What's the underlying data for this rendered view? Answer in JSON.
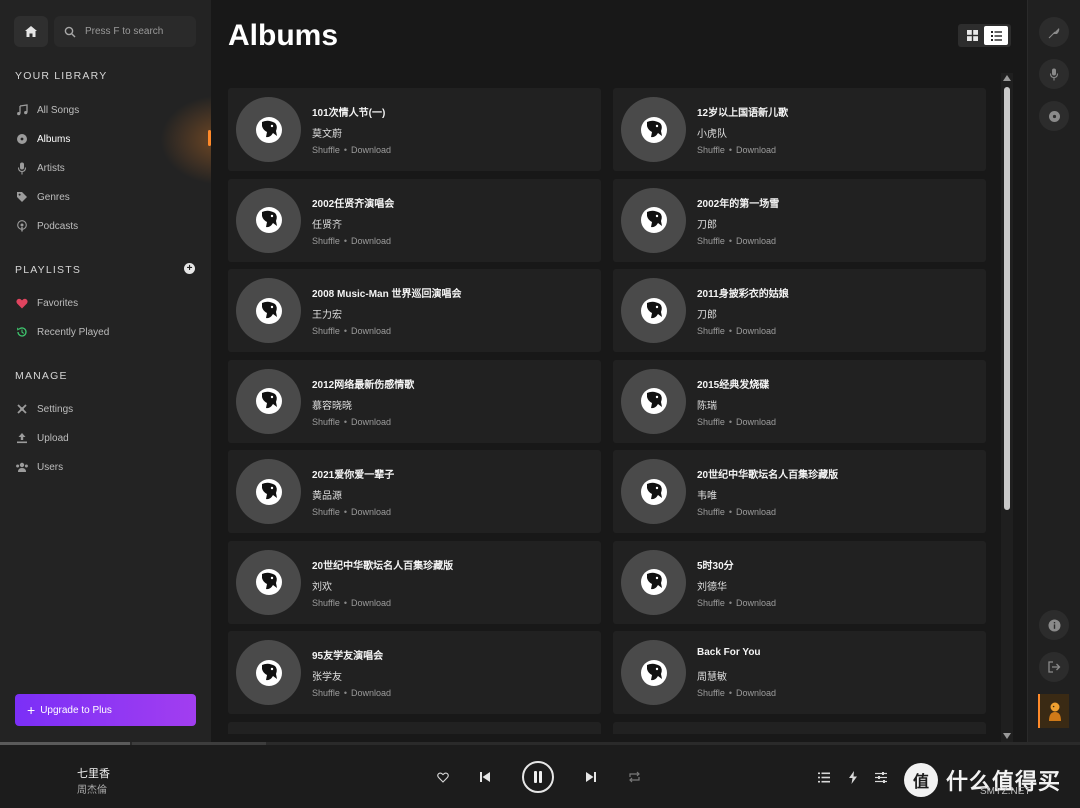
{
  "search": {
    "placeholder": "Press F to search"
  },
  "sidebar": {
    "library_title": "YOUR LIBRARY",
    "library_items": [
      {
        "label": "All Songs",
        "icon": "music-note-icon"
      },
      {
        "label": "Albums",
        "icon": "disc-icon",
        "active": true
      },
      {
        "label": "Artists",
        "icon": "microphone-icon"
      },
      {
        "label": "Genres",
        "icon": "tag-icon"
      },
      {
        "label": "Podcasts",
        "icon": "podcast-icon"
      }
    ],
    "playlists_title": "PLAYLISTS",
    "playlist_items": [
      {
        "label": "Favorites",
        "icon": "heart-icon"
      },
      {
        "label": "Recently Played",
        "icon": "history-icon"
      }
    ],
    "manage_title": "MANAGE",
    "manage_items": [
      {
        "label": "Settings",
        "icon": "settings-icon"
      },
      {
        "label": "Upload",
        "icon": "upload-icon"
      },
      {
        "label": "Users",
        "icon": "users-icon"
      }
    ],
    "upgrade_label": "Upgrade to Plus"
  },
  "main": {
    "title": "Albums",
    "actions": {
      "shuffle": "Shuffle",
      "separator": "•",
      "download": "Download"
    },
    "albums": [
      {
        "title": "101次情人节(一)",
        "artist": "莫文蔚"
      },
      {
        "title": "12岁以上国语新儿歌",
        "artist": "小虎队"
      },
      {
        "title": "2002任贤齐演唱会",
        "artist": "任贤齐"
      },
      {
        "title": "2002年的第一场雪",
        "artist": "刀郎"
      },
      {
        "title": "2008 Music-Man 世界巡回演唱会",
        "artist": "王力宏"
      },
      {
        "title": "2011身披彩衣的姑娘",
        "artist": "刀郎"
      },
      {
        "title": "2012网络最新伤感情歌",
        "artist": "慕容晓晓"
      },
      {
        "title": "2015经典发烧碟",
        "artist": "陈瑞"
      },
      {
        "title": "2021爱你爱一辈子",
        "artist": "黄品源"
      },
      {
        "title": "20世纪中华歌坛名人百集珍藏版",
        "artist": "韦唯"
      },
      {
        "title": "20世纪中华歌坛名人百集珍藏版",
        "artist": "刘欢"
      },
      {
        "title": "5时30分",
        "artist": "刘德华"
      },
      {
        "title": "95友学友演唱会",
        "artist": "张学友"
      },
      {
        "title": "Back For You",
        "artist": "周慧敏"
      }
    ]
  },
  "player": {
    "song_title": "七里香",
    "song_artist": "周杰倫",
    "progress_fraction": 0.12
  },
  "watermark": {
    "text": "什么值得买",
    "sub": "SMYZ.NET",
    "logo": "值"
  },
  "colors": {
    "accent": "#ff8a2a",
    "upgrade_start": "#7b2ff7",
    "upgrade_end": "#a23ef0",
    "favorites": "#e0445f",
    "recent": "#3ec46d"
  }
}
